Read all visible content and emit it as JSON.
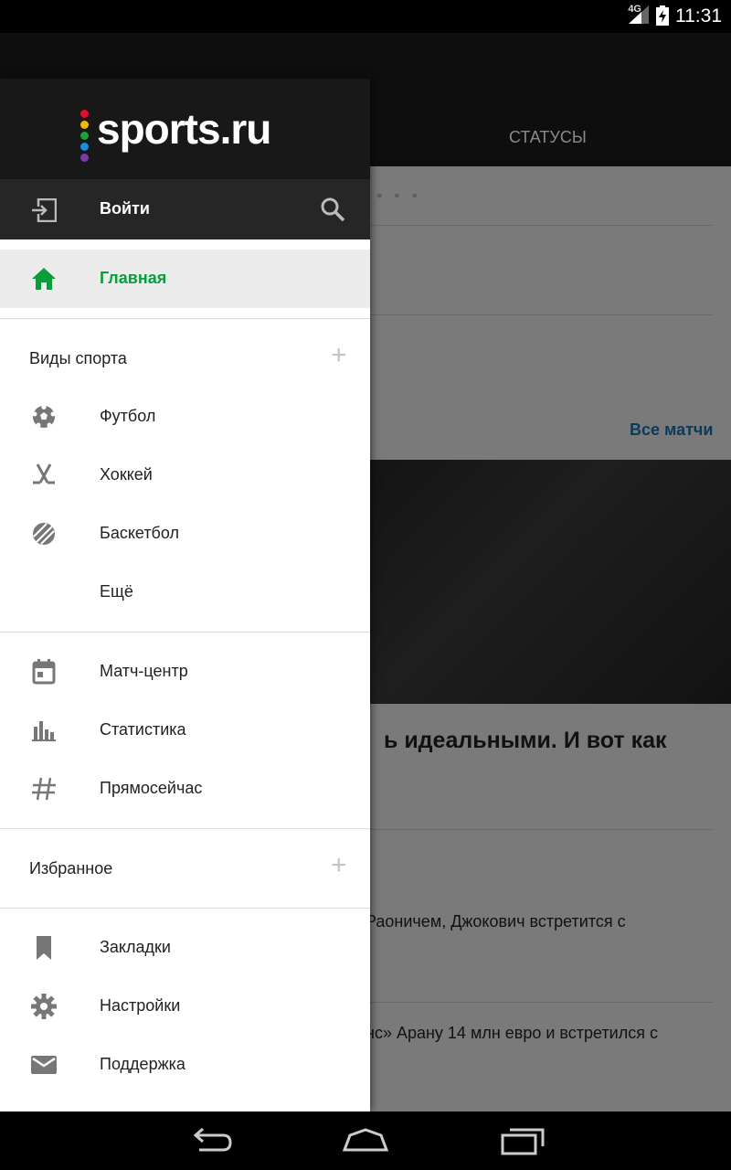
{
  "status_bar": {
    "network": "4G",
    "time": "11:31"
  },
  "background": {
    "tab_statuses": "СТАТУСЫ",
    "all_matches": "Все матчи",
    "headline_fragment": "ь идеальными. И вот как",
    "text_line_1": "Раоничем, Джокович встретится с",
    "text_line_2": "нс» Арану 14 млн евро и встретился с"
  },
  "drawer": {
    "logo": "sports.ru",
    "login_label": "Войти",
    "home_label": "Главная",
    "sports_section": {
      "title": "Виды спорта",
      "plus": "+",
      "items": [
        {
          "label": "Футбол",
          "icon": "soccer-ball-icon"
        },
        {
          "label": "Хоккей",
          "icon": "hockey-sticks-icon"
        },
        {
          "label": "Баскетбол",
          "icon": "basketball-icon"
        },
        {
          "label": "Ещё",
          "icon": ""
        }
      ]
    },
    "tools": [
      {
        "label": "Матч-центр",
        "icon": "calendar-icon"
      },
      {
        "label": "Статистика",
        "icon": "bar-chart-icon"
      },
      {
        "label": "Прямосейчас",
        "icon": "hashtag-icon"
      }
    ],
    "favorites_section": {
      "title": "Избранное",
      "plus": "+"
    },
    "settings": [
      {
        "label": "Закладки",
        "icon": "bookmark-icon"
      },
      {
        "label": "Настройки",
        "icon": "gear-icon"
      },
      {
        "label": "Поддержка",
        "icon": "mail-icon"
      }
    ]
  },
  "colors": {
    "accent_green": "#0a9e3a",
    "logo_dots": [
      "#e3102a",
      "#f2b800",
      "#1aa23a",
      "#1a8de0",
      "#7b3aa6"
    ]
  }
}
